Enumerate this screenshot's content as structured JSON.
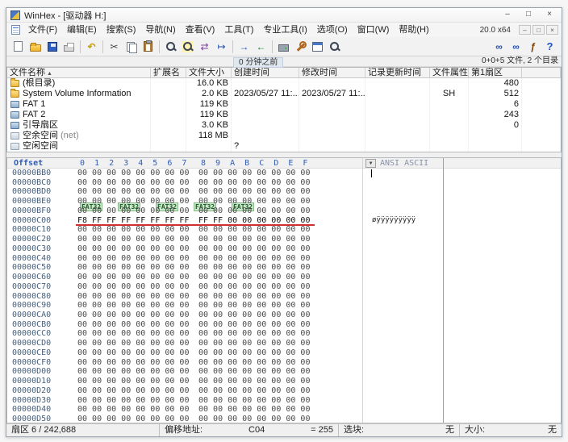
{
  "window": {
    "title": "WinHex - [驱动器 H:]",
    "version_label": "20.0 x64"
  },
  "titlebar": {
    "minimize_glyph": "–",
    "maximize_glyph": "□",
    "close_glyph": "×"
  },
  "child_controls": {
    "minimize": "–",
    "restore": "□",
    "close": "×"
  },
  "menu": {
    "items": [
      "文件(F)",
      "编辑(E)",
      "搜索(S)",
      "导航(N)",
      "查看(V)",
      "工具(T)",
      "专业工具(I)",
      "选项(O)",
      "窗口(W)",
      "帮助(H)"
    ]
  },
  "toolbar": {
    "groups": [
      {
        "icons": [
          {
            "n": "new-file"
          },
          {
            "n": "open-folder"
          },
          {
            "n": "save"
          },
          {
            "n": "print"
          }
        ]
      },
      {
        "icons": [
          {
            "n": "undo",
            "g": "↶"
          }
        ]
      },
      {
        "icons": [
          {
            "n": "cut",
            "g": "✂"
          },
          {
            "n": "copy"
          },
          {
            "n": "paste"
          }
        ]
      },
      {
        "icons": [
          {
            "n": "find-text"
          },
          {
            "n": "find-hex"
          },
          {
            "n": "replace",
            "g": "⇄"
          },
          {
            "n": "goto-offset",
            "g": "↦"
          }
        ]
      },
      {
        "icons": [
          {
            "n": "navigate-forward",
            "g": "→"
          },
          {
            "n": "navigate-back",
            "g": "←"
          }
        ]
      },
      {
        "icons": [
          {
            "n": "disk-tools"
          },
          {
            "n": "tools"
          },
          {
            "n": "data-interpreter"
          },
          {
            "n": "magnifier"
          }
        ]
      }
    ],
    "right_icons": [
      {
        "n": "link-sectors",
        "g": "∞"
      },
      {
        "n": "link-positions",
        "g": "∞"
      },
      {
        "n": "scripts",
        "g": "ƒ"
      },
      {
        "n": "help",
        "g": "?"
      }
    ]
  },
  "dir_info_bar": {
    "snapshot_age": "0 分钟之前",
    "summary": "0+0+5 文件, 2 个目录"
  },
  "file_list": {
    "columns": [
      {
        "label": "文件名称",
        "sort": "▲"
      },
      {
        "label": "扩展名"
      },
      {
        "label": "文件大小"
      },
      {
        "label": "创建时间"
      },
      {
        "label": "修改时间"
      },
      {
        "label": "记录更新时间"
      },
      {
        "label": "文件属性"
      },
      {
        "label": "第1扇区"
      },
      {
        "label": ""
      }
    ],
    "rows": [
      {
        "icon": "folder",
        "name": "(根目录)",
        "ext": "",
        "size": "16.0 KB",
        "created": "",
        "modified": "",
        "updated": "",
        "attr": "",
        "sector": "480"
      },
      {
        "icon": "folder",
        "name": "System Volume Information",
        "ext": "",
        "size": "2.0 KB",
        "created": "2023/05/27 11:...",
        "modified": "2023/05/27 11:...",
        "updated": "",
        "attr": "SH",
        "sector": "512"
      },
      {
        "icon": "volume",
        "name": "FAT 1",
        "ext": "",
        "size": "119 KB",
        "created": "",
        "modified": "",
        "updated": "",
        "attr": "",
        "sector": "6"
      },
      {
        "icon": "volume",
        "name": "FAT 2",
        "ext": "",
        "size": "119 KB",
        "created": "",
        "modified": "",
        "updated": "",
        "attr": "",
        "sector": "243"
      },
      {
        "icon": "volume",
        "name": "引导扇区",
        "ext": "",
        "size": "3.0 KB",
        "created": "",
        "modified": "",
        "updated": "",
        "attr": "",
        "sector": "0"
      },
      {
        "icon": "free",
        "name": "空余空间",
        "name_suffix": "(net)",
        "ext": "",
        "size": "118 MB",
        "created": "",
        "modified": "",
        "updated": "",
        "attr": "",
        "sector": ""
      },
      {
        "icon": "free",
        "name": "空闲空间",
        "ext": "",
        "size": "",
        "created": "?",
        "modified": "",
        "updated": "",
        "attr": "",
        "sector": ""
      }
    ]
  },
  "hex": {
    "offset_label": "Offset",
    "cols": [
      "0",
      "1",
      "2",
      "3",
      "4",
      "5",
      "6",
      "7",
      "8",
      "9",
      "A",
      "B",
      "C",
      "D",
      "E",
      "F"
    ],
    "ascii_label": "ANSI ASCII",
    "charset_dropdown_glyph": "▼",
    "rows": [
      {
        "o": "00000BB0",
        "h1": "00 00 00 00 00 00 00 00",
        "h2": "00 00 00 00 00 00 00 00",
        "a": ""
      },
      {
        "o": "00000BC0",
        "h1": "00 00 00 00 00 00 00 00",
        "h2": "00 00 00 00 00 00 00 00",
        "a": ""
      },
      {
        "o": "00000BD0",
        "h1": "00 00 00 00 00 00 00 00",
        "h2": "00 00 00 00 00 00 00 00",
        "a": ""
      },
      {
        "o": "00000BE0",
        "h1": "00 00 00 00 00 00 00 00",
        "h2": "00 00 00 00 00 00 00 00",
        "a": ""
      },
      {
        "o": "00000BF0",
        "h1": "00 00 00 00 00 00 00 00",
        "h2": "00 00 00 00 00 00 00 00",
        "a": ""
      },
      {
        "o": "00000C00",
        "h1": "F8 FF FF FF FF FF FF FF",
        "h2": "FF FF 00 00 00 00 00 00",
        "a": "øÿÿÿÿÿÿÿÿÿ"
      },
      {
        "o": "00000C10",
        "h1": "00 00 00 00 00 00 00 00",
        "h2": "00 00 00 00 00 00 00 00",
        "a": ""
      },
      {
        "o": "00000C20",
        "h1": "00 00 00 00 00 00 00 00",
        "h2": "00 00 00 00 00 00 00 00",
        "a": ""
      },
      {
        "o": "00000C30",
        "h1": "00 00 00 00 00 00 00 00",
        "h2": "00 00 00 00 00 00 00 00",
        "a": ""
      },
      {
        "o": "00000C40",
        "h1": "00 00 00 00 00 00 00 00",
        "h2": "00 00 00 00 00 00 00 00",
        "a": ""
      },
      {
        "o": "00000C50",
        "h1": "00 00 00 00 00 00 00 00",
        "h2": "00 00 00 00 00 00 00 00",
        "a": ""
      },
      {
        "o": "00000C60",
        "h1": "00 00 00 00 00 00 00 00",
        "h2": "00 00 00 00 00 00 00 00",
        "a": ""
      },
      {
        "o": "00000C70",
        "h1": "00 00 00 00 00 00 00 00",
        "h2": "00 00 00 00 00 00 00 00",
        "a": ""
      },
      {
        "o": "00000C80",
        "h1": "00 00 00 00 00 00 00 00",
        "h2": "00 00 00 00 00 00 00 00",
        "a": ""
      },
      {
        "o": "00000C90",
        "h1": "00 00 00 00 00 00 00 00",
        "h2": "00 00 00 00 00 00 00 00",
        "a": ""
      },
      {
        "o": "00000CA0",
        "h1": "00 00 00 00 00 00 00 00",
        "h2": "00 00 00 00 00 00 00 00",
        "a": ""
      },
      {
        "o": "00000CB0",
        "h1": "00 00 00 00 00 00 00 00",
        "h2": "00 00 00 00 00 00 00 00",
        "a": ""
      },
      {
        "o": "00000CC0",
        "h1": "00 00 00 00 00 00 00 00",
        "h2": "00 00 00 00 00 00 00 00",
        "a": ""
      },
      {
        "o": "00000CD0",
        "h1": "00 00 00 00 00 00 00 00",
        "h2": "00 00 00 00 00 00 00 00",
        "a": ""
      },
      {
        "o": "00000CE0",
        "h1": "00 00 00 00 00 00 00 00",
        "h2": "00 00 00 00 00 00 00 00",
        "a": ""
      },
      {
        "o": "00000CF0",
        "h1": "00 00 00 00 00 00 00 00",
        "h2": "00 00 00 00 00 00 00 00",
        "a": ""
      },
      {
        "o": "00000D00",
        "h1": "00 00 00 00 00 00 00 00",
        "h2": "00 00 00 00 00 00 00 00",
        "a": ""
      },
      {
        "o": "00000D10",
        "h1": "00 00 00 00 00 00 00 00",
        "h2": "00 00 00 00 00 00 00 00",
        "a": ""
      },
      {
        "o": "00000D20",
        "h1": "00 00 00 00 00 00 00 00",
        "h2": "00 00 00 00 00 00 00 00",
        "a": ""
      },
      {
        "o": "00000D30",
        "h1": "00 00 00 00 00 00 00 00",
        "h2": "00 00 00 00 00 00 00 00",
        "a": ""
      },
      {
        "o": "00000D40",
        "h1": "00 00 00 00 00 00 00 00",
        "h2": "00 00 00 00 00 00 00 00",
        "a": ""
      },
      {
        "o": "00000D50",
        "h1": "00 00 00 00 00 00 00 00",
        "h2": "00 00 00 00 00 00 00 00",
        "a": ""
      }
    ],
    "annotations": {
      "fat32_labels": [
        "FAT32",
        "FAT32",
        "FAT32",
        "FAT32",
        "FAT32"
      ]
    }
  },
  "status_bar": {
    "sector_info": "扇区 6 / 242,688",
    "offset_label": "偏移地址:",
    "offset_value": "C04",
    "byte_value": "= 255",
    "block_label": "选块:",
    "block_value": "无",
    "size_label": "大小:",
    "size_value": "无"
  }
}
